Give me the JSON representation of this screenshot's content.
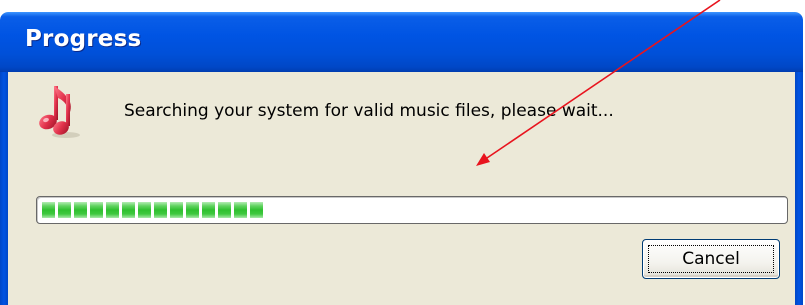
{
  "window": {
    "title": "Progress",
    "titlebar_color": "#0054e3",
    "body_color": "#ece9d8"
  },
  "dialog": {
    "icon": "music-note-icon",
    "icon_color": "#e0304a",
    "message": "Searching your system for valid music files, please wait..."
  },
  "progress": {
    "value_fraction": 0.3,
    "fill_color": "#2fc02f"
  },
  "buttons": {
    "cancel_label": "Cancel"
  },
  "annotation": {
    "arrow_color": "#e8141e"
  }
}
